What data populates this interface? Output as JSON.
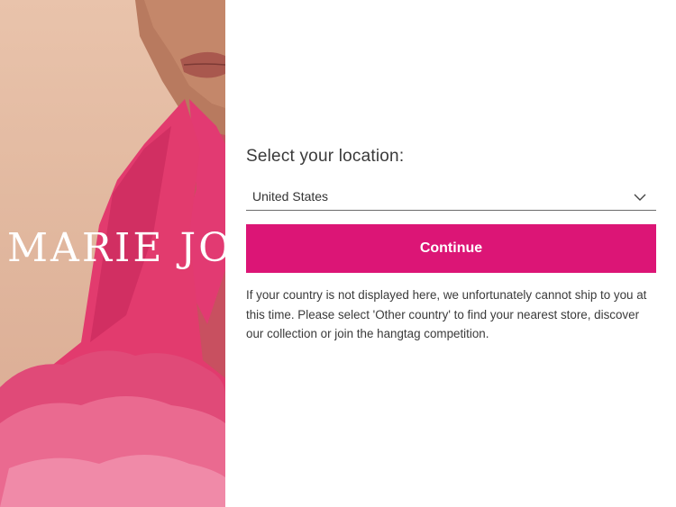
{
  "brand": {
    "logo_text": "MARIE JO"
  },
  "location": {
    "title": "Select your location:",
    "selected_country": "United States",
    "continue_label": "Continue",
    "info_text": "If your country is not displayed here, we unfortunately cannot ship to you at this time. Please select 'Other country' to find your nearest store, discover our collection or join the hangtag competition."
  },
  "colors": {
    "accent": "#dc1576",
    "text": "#3a3a3a",
    "background": "#ffffff"
  },
  "icons": {
    "select_chevron": "chevron-down-icon"
  }
}
